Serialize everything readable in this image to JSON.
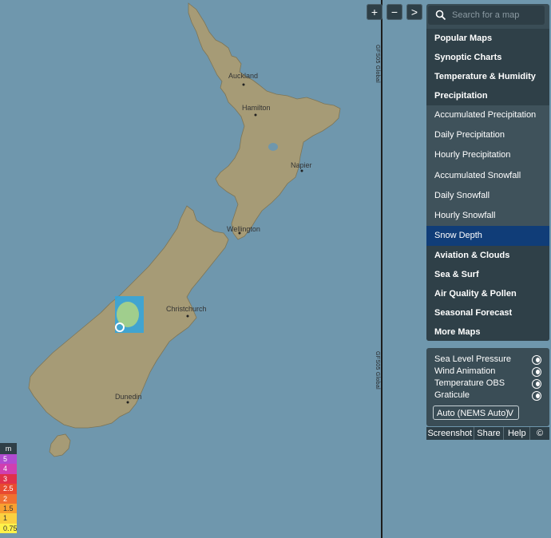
{
  "map": {
    "cities": [
      {
        "name": "Auckland"
      },
      {
        "name": "Hamilton"
      },
      {
        "name": "Napier"
      },
      {
        "name": "Wellington"
      },
      {
        "name": "Christchurch"
      },
      {
        "name": "Dunedin"
      }
    ],
    "gfs_label_top": "GFS05 Global",
    "gfs_label_bottom": "GFS05 Global",
    "water_color": "#6f97ad",
    "land_color": "#a69b76"
  },
  "zoom": {
    "plus": "+",
    "minus": "−",
    "next": ">"
  },
  "search": {
    "placeholder": "Search for a map"
  },
  "menu": [
    {
      "label": "Popular Maps",
      "kind": "bold"
    },
    {
      "label": "Synoptic Charts",
      "kind": "bold"
    },
    {
      "label": "Temperature & Humidity",
      "kind": "bold"
    },
    {
      "label": "Precipitation",
      "kind": "bold"
    },
    {
      "label": "Accumulated Precipitation",
      "kind": "sub"
    },
    {
      "label": "Daily Precipitation",
      "kind": "sub"
    },
    {
      "label": "Hourly Precipitation",
      "kind": "sub"
    },
    {
      "label": "Accumulated Snowfall",
      "kind": "sub"
    },
    {
      "label": "Daily Snowfall",
      "kind": "sub"
    },
    {
      "label": "Hourly Snowfall",
      "kind": "sub"
    },
    {
      "label": "Snow Depth",
      "kind": "active"
    },
    {
      "label": "Aviation & Clouds",
      "kind": "bold"
    },
    {
      "label": "Sea & Surf",
      "kind": "bold"
    },
    {
      "label": "Air Quality & Pollen",
      "kind": "bold"
    },
    {
      "label": "Seasonal Forecast",
      "kind": "bold"
    },
    {
      "label": "More Maps",
      "kind": "bold"
    }
  ],
  "layers": [
    {
      "label": "Sea Level Pressure",
      "on": true
    },
    {
      "label": "Wind Animation",
      "on": true
    },
    {
      "label": "Temperature OBS",
      "on": true
    },
    {
      "label": "Graticule",
      "on": true
    }
  ],
  "model_select": {
    "value": "Auto (NEMS Auto)"
  },
  "footer": {
    "screenshot": "Screenshot",
    "share": "Share",
    "help": "Help",
    "copyright": "©"
  },
  "legend": {
    "unit": "m",
    "entries": [
      {
        "value": "5",
        "color": "#b04bd0"
      },
      {
        "value": "4",
        "color": "#d03fb0"
      },
      {
        "value": "3",
        "color": "#e0304a"
      },
      {
        "value": "2.5",
        "color": "#e84a30"
      },
      {
        "value": "2",
        "color": "#f07030"
      },
      {
        "value": "1.5",
        "color": "#f8a030"
      },
      {
        "value": "1",
        "color": "#fbd040"
      },
      {
        "value": "0.75",
        "color": "#fff24a"
      }
    ]
  }
}
